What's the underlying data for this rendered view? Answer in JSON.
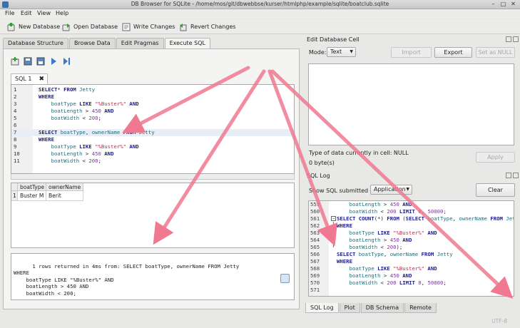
{
  "window": {
    "title": "DB Browser for SQLite - /home/mos/git/dbwebbse/kurser/htmlphp/example/sqlite/boatclub.sqlite",
    "btn_min": "–",
    "btn_max": "□",
    "btn_close": "✕"
  },
  "menu": {
    "file": "File",
    "edit": "Edit",
    "view": "View",
    "help": "Help"
  },
  "toolbar": {
    "new_db": "New Database",
    "open_db": "Open Database",
    "write_changes": "Write Changes",
    "revert_changes": "Revert Changes"
  },
  "main_tabs": {
    "structure": "Database Structure",
    "browse": "Browse Data",
    "pragmas": "Edit Pragmas",
    "execute": "Execute SQL"
  },
  "sql_tab": {
    "label": "SQL 1",
    "close": "✖"
  },
  "editor": {
    "lines": [
      {
        "n": "1",
        "parts": [
          [
            "kw",
            "SELECT"
          ],
          [
            "",
            "* "
          ],
          [
            "kw",
            "FROM"
          ],
          [
            "id",
            " Jetty"
          ]
        ]
      },
      {
        "n": "2",
        "parts": [
          [
            "kw",
            "WHERE"
          ]
        ]
      },
      {
        "n": "3",
        "parts": [
          [
            "",
            "    "
          ],
          [
            "id",
            "boatType"
          ],
          [
            "kw",
            " LIKE "
          ],
          [
            "str",
            "\"%Buster%\""
          ],
          [
            "kw",
            " AND"
          ]
        ]
      },
      {
        "n": "4",
        "parts": [
          [
            "",
            "    "
          ],
          [
            "id",
            "boatLength"
          ],
          [
            "",
            " > "
          ],
          [
            "num",
            "450"
          ],
          [
            "kw",
            " AND"
          ]
        ]
      },
      {
        "n": "5",
        "parts": [
          [
            "",
            "    "
          ],
          [
            "id",
            "boatWidth"
          ],
          [
            "",
            " < "
          ],
          [
            "num",
            "200"
          ],
          [
            "",
            ";"
          ]
        ]
      },
      {
        "n": "6",
        "parts": []
      },
      {
        "n": "7",
        "parts": [
          [
            "kw",
            "SELECT "
          ],
          [
            "id",
            "boatType"
          ],
          [
            "",
            ", "
          ],
          [
            "id",
            "ownerName"
          ],
          [
            "kw",
            " FROM"
          ],
          [
            "id",
            " Jetty"
          ]
        ],
        "current": true
      },
      {
        "n": "8",
        "parts": [
          [
            "kw",
            "WHERE"
          ]
        ]
      },
      {
        "n": "9",
        "parts": [
          [
            "",
            "    "
          ],
          [
            "id",
            "boatType"
          ],
          [
            "kw",
            " LIKE "
          ],
          [
            "str",
            "\"%Buster%\""
          ],
          [
            "kw",
            " AND"
          ]
        ]
      },
      {
        "n": "10",
        "parts": [
          [
            "",
            "    "
          ],
          [
            "id",
            "boatLength"
          ],
          [
            "",
            " > "
          ],
          [
            "num",
            "450"
          ],
          [
            "kw",
            " AND"
          ]
        ]
      },
      {
        "n": "11",
        "parts": [
          [
            "",
            "    "
          ],
          [
            "id",
            "boatWidth"
          ],
          [
            "",
            " < "
          ],
          [
            "num",
            "200"
          ],
          [
            "",
            ";"
          ]
        ]
      }
    ]
  },
  "results": {
    "columns": [
      "boatType",
      "ownerName"
    ],
    "rows": [
      {
        "index": "1",
        "boatType": "Buster M",
        "ownerName": "Berit"
      }
    ]
  },
  "message": "1 rows returned in 4ms from: SELECT boatType, ownerName FROM Jetty\nWHERE\n    boatType LIKE \"%Buster%\" AND\n    boatLength > 450 AND\n    boatWidth < 200;",
  "edit_cell": {
    "title": "Edit Database Cell",
    "mode_label": "Mode:",
    "mode_value": "Text",
    "import": "Import",
    "export": "Export",
    "set_null": "Set as NULL",
    "type_info": "Type of data currently in cell: NULL",
    "size_info": "0 byte(s)",
    "apply": "Apply"
  },
  "sql_log": {
    "title": "SQL Log",
    "show_label": "Show SQL submitted by",
    "source": "Application",
    "clear": "Clear",
    "lines": [
      {
        "n": "559",
        "parts": [
          [
            "",
            "    "
          ],
          [
            "id",
            "boatLength"
          ],
          [
            "",
            " > "
          ],
          [
            "num",
            "450"
          ],
          [
            "kw",
            " AND"
          ]
        ]
      },
      {
        "n": "560",
        "parts": [
          [
            "",
            "    "
          ],
          [
            "id",
            "boatWidth"
          ],
          [
            "",
            " < "
          ],
          [
            "num",
            "200"
          ],
          [
            "kw",
            " LIMIT "
          ],
          [
            "num",
            "0"
          ],
          [
            "",
            ", "
          ],
          [
            "num",
            "50000"
          ],
          [
            "",
            ";"
          ]
        ]
      },
      {
        "n": "561",
        "parts": [
          [
            "kw",
            "SELECT COUNT"
          ],
          [
            "",
            "(*) "
          ],
          [
            "kw",
            "FROM "
          ],
          [
            "",
            "("
          ],
          [
            "kw",
            "SELECT "
          ],
          [
            "id",
            "boatType"
          ],
          [
            "",
            ", "
          ],
          [
            "id",
            "ownerName"
          ],
          [
            "kw",
            " FROM"
          ],
          [
            "id",
            " Jetty"
          ]
        ],
        "fold": true
      },
      {
        "n": "562",
        "parts": [
          [
            "kw",
            "WHERE"
          ]
        ]
      },
      {
        "n": "563",
        "parts": [
          [
            "",
            "    "
          ],
          [
            "id",
            "boatType"
          ],
          [
            "kw",
            " LIKE "
          ],
          [
            "str",
            "\"%Buster%\""
          ],
          [
            "kw",
            " AND"
          ]
        ]
      },
      {
        "n": "564",
        "parts": [
          [
            "",
            "    "
          ],
          [
            "id",
            "boatLength"
          ],
          [
            "",
            " > "
          ],
          [
            "num",
            "450"
          ],
          [
            "kw",
            " AND"
          ]
        ]
      },
      {
        "n": "565",
        "parts": [
          [
            "",
            "    "
          ],
          [
            "id",
            "boatWidth"
          ],
          [
            "",
            " < "
          ],
          [
            "num",
            "200"
          ],
          [
            "",
            ");"
          ]
        ]
      },
      {
        "n": "566",
        "parts": [
          [
            "kw",
            "SELECT "
          ],
          [
            "id",
            "boatType"
          ],
          [
            "",
            ", "
          ],
          [
            "id",
            "ownerName"
          ],
          [
            "kw",
            " FROM"
          ],
          [
            "id",
            " Jetty"
          ]
        ]
      },
      {
        "n": "567",
        "parts": [
          [
            "kw",
            "WHERE"
          ]
        ]
      },
      {
        "n": "568",
        "parts": [
          [
            "",
            "    "
          ],
          [
            "id",
            "boatType"
          ],
          [
            "kw",
            " LIKE "
          ],
          [
            "str",
            "\"%Buster%\""
          ],
          [
            "kw",
            " AND"
          ]
        ]
      },
      {
        "n": "569",
        "parts": [
          [
            "",
            "    "
          ],
          [
            "id",
            "boatLength"
          ],
          [
            "",
            " > "
          ],
          [
            "num",
            "450"
          ],
          [
            "kw",
            " AND"
          ]
        ]
      },
      {
        "n": "570",
        "parts": [
          [
            "",
            "    "
          ],
          [
            "id",
            "boatWidth"
          ],
          [
            "",
            " < "
          ],
          [
            "num",
            "200"
          ],
          [
            "kw",
            " LIMIT "
          ],
          [
            "num",
            "0"
          ],
          [
            "",
            ", "
          ],
          [
            "num",
            "50000"
          ],
          [
            "",
            ";"
          ]
        ]
      },
      {
        "n": "571",
        "parts": []
      }
    ]
  },
  "bottom_tabs": {
    "sql_log": "SQL Log",
    "plot": "Plot",
    "schema": "DB Schema",
    "remote": "Remote"
  },
  "status": {
    "encoding": "UTF-8"
  },
  "colors": {
    "annotation_arrow": "#f07890",
    "keyword": "#1c1c8a",
    "identifier": "#1a6f7f",
    "string": "#c0304a"
  }
}
